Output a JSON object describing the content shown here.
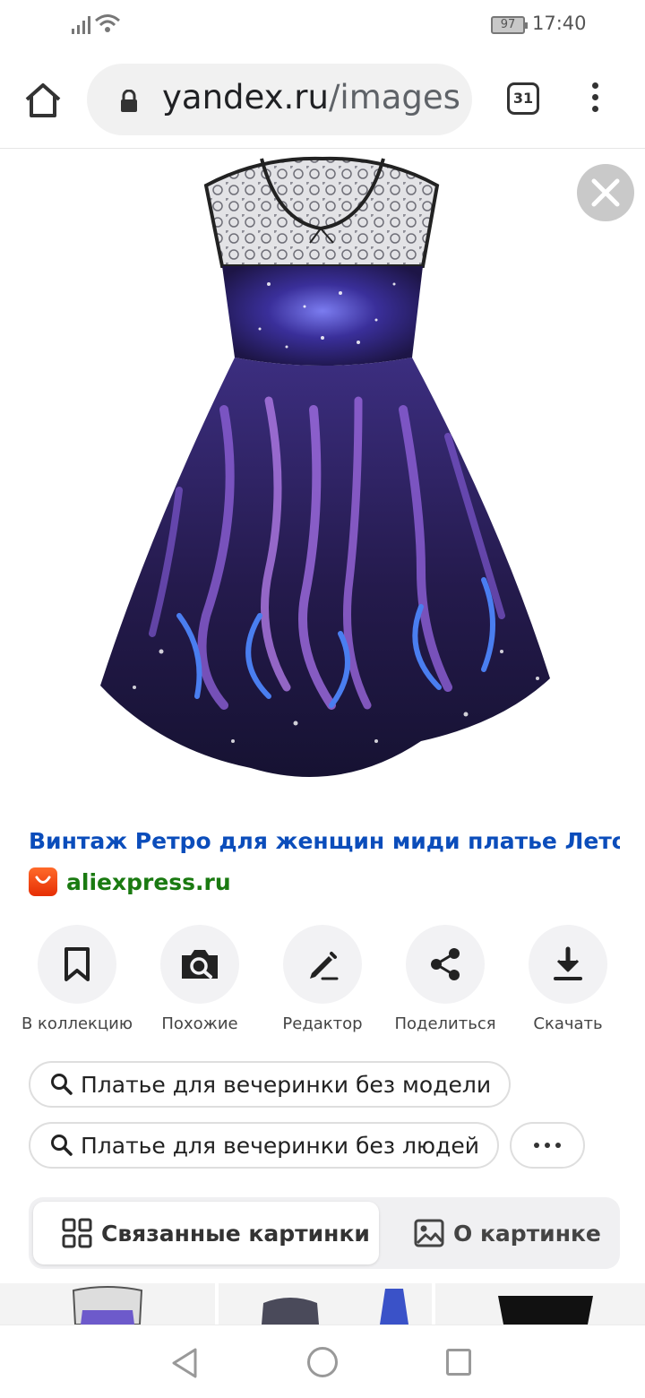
{
  "status_bar": {
    "battery": "97",
    "time": "17:40"
  },
  "toolbar": {
    "url_host": "yandex.ru",
    "url_path": "/images",
    "tab_count": "31"
  },
  "result": {
    "title": "Винтаж Ретро для женщин миди платье Лето ...",
    "source": "aliexpress.ru"
  },
  "actions": [
    {
      "label": "В коллекцию",
      "icon": "bookmark-icon"
    },
    {
      "label": "Похожие",
      "icon": "camera-search-icon"
    },
    {
      "label": "Редактор",
      "icon": "pencil-icon"
    },
    {
      "label": "Поделиться",
      "icon": "share-icon"
    },
    {
      "label": "Скачать",
      "icon": "download-icon"
    }
  ],
  "suggestions": [
    "Платье для вечеринки без модели",
    "Платье для вечеринки без людей"
  ],
  "tabs": {
    "related": "Связанные картинки",
    "about": "О картинке"
  },
  "colors": {
    "link": "#0b4dbb",
    "source": "#1a7a11",
    "dress": "#2a1f4e"
  }
}
